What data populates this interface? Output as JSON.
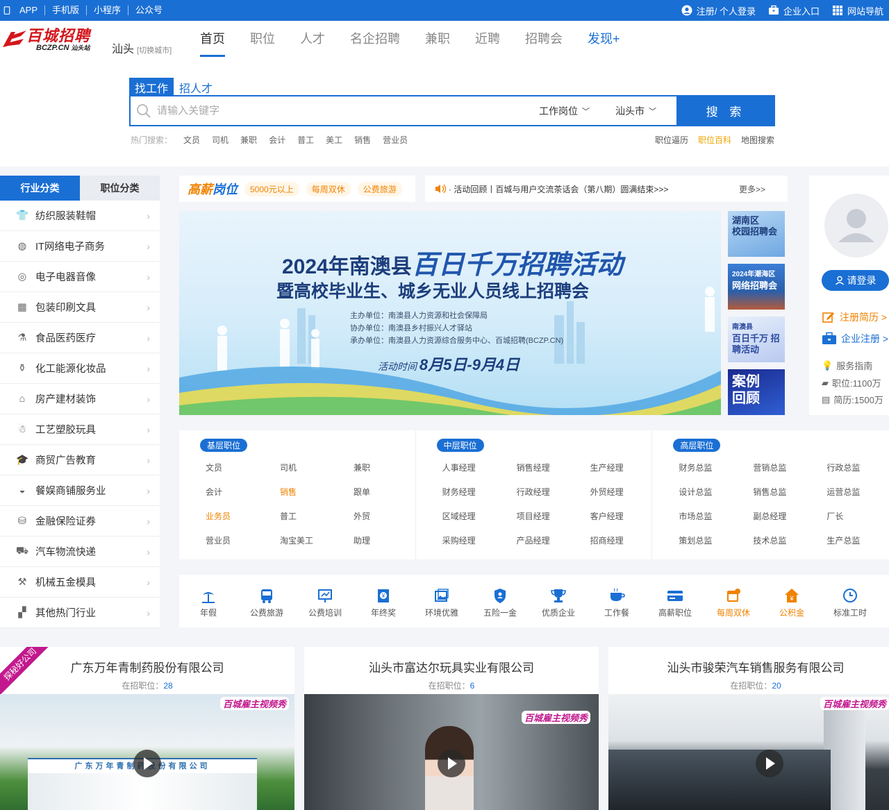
{
  "topbar": {
    "left": [
      "APP",
      "手机版",
      "小程序",
      "公众号"
    ],
    "register_login": "注册/ 个人登录",
    "enterprise": "企业入口",
    "sitenav": "网站导航"
  },
  "header": {
    "logo_cn": "百城招聘",
    "logo_en": "BCZP.CN",
    "logo_sub": "汕头站",
    "city": "汕头",
    "switch_city": "[切换城市]",
    "nav": [
      "首页",
      "职位",
      "人才",
      "名企招聘",
      "兼职",
      "近聘",
      "招聘会",
      "发现+"
    ]
  },
  "search": {
    "tabs": [
      "找工作",
      "招人才"
    ],
    "placeholder": "请输入关键字",
    "type_select": "工作岗位",
    "city_select": "汕头市",
    "button": "搜 索",
    "hot_label": "热门搜索：",
    "hot_words": [
      "文员",
      "司机",
      "兼职",
      "会计",
      "普工",
      "美工",
      "销售",
      "营业员"
    ],
    "links": [
      "职位逼历",
      "职位百科",
      "地图搜索"
    ]
  },
  "category": {
    "tabs": [
      "行业分类",
      "职位分类"
    ],
    "items": [
      {
        "label": "纺织服装鞋帽",
        "icon": "shirt-icon"
      },
      {
        "label": "IT网络电子商务",
        "icon": "globe-icon"
      },
      {
        "label": "电子电器音像",
        "icon": "disc-icon"
      },
      {
        "label": "包装印刷文具",
        "icon": "package-icon"
      },
      {
        "label": "食品医药医疗",
        "icon": "pill-icon"
      },
      {
        "label": "化工能源化妆品",
        "icon": "flask-icon"
      },
      {
        "label": "房产建材装饰",
        "icon": "house-icon"
      },
      {
        "label": "工艺塑胶玩具",
        "icon": "toy-icon"
      },
      {
        "label": "商贸广告教育",
        "icon": "graduation-icon"
      },
      {
        "label": "餐娱商铺服务业",
        "icon": "dish-icon"
      },
      {
        "label": "金融保险证券",
        "icon": "coins-icon"
      },
      {
        "label": "汽车物流快递",
        "icon": "truck-icon"
      },
      {
        "label": "机械五金模具",
        "icon": "wrench-icon"
      },
      {
        "label": "其他热门行业",
        "icon": "blocks-icon"
      }
    ]
  },
  "highpay": {
    "logo_a": "高薪",
    "logo_b": "岗位",
    "chips": [
      "5000元以上",
      "每周双休",
      "公费旅游"
    ]
  },
  "notice": {
    "text": "· 活动回顾丨百城与用户交流茶话会（第八期）圆满结束>>>",
    "more": "更多>>"
  },
  "banner": {
    "year": "2024年南澳县",
    "highlight": "百日千万招聘活动",
    "subtitle": "暨高校毕业生、城乡无业人员线上招聘会",
    "org_host": "主办单位：南澳县人力资源和社会保障局",
    "org_co": "协办单位：南澳县乡村振兴人才驿站",
    "org_exec": "承办单位：南澳县人力资源综合服务中心、百城招聘(BCZP.CN)",
    "date_label": "活动时间",
    "date_value": "8月5日-9月4日"
  },
  "thumbs": [
    {
      "line1": "湖南区",
      "line2": "校园招聘会"
    },
    {
      "line1": "2024年潮海区",
      "line2": "网络招聘会"
    },
    {
      "line1": "南澳县",
      "line2": "百日千万 招聘活动"
    },
    {
      "line1": "案例",
      "line2": "回顾"
    }
  ],
  "user": {
    "login": "请登录",
    "register_resume": "注册简历 >",
    "register_company": "企业注册 >",
    "guide": "服务指南",
    "jobs": "职位:1100万",
    "resumes": "简历:1500万"
  },
  "positions": [
    {
      "tag": "基层职位",
      "items": [
        "文员",
        "司机",
        "兼职",
        "会计",
        "销售",
        "跟单",
        "业务员",
        "普工",
        "外贸",
        "营业员",
        "淘宝美工",
        "助理"
      ],
      "orange": [
        4,
        6
      ]
    },
    {
      "tag": "中层职位",
      "items": [
        "人事经理",
        "销售经理",
        "生产经理",
        "财务经理",
        "行政经理",
        "外贸经理",
        "区域经理",
        "项目经理",
        "客户经理",
        "采购经理",
        "产品经理",
        "招商经理"
      ],
      "orange": []
    },
    {
      "tag": "高层职位",
      "items": [
        "财务总监",
        "营销总监",
        "行政总监",
        "设计总监",
        "销售总监",
        "运营总监",
        "市场总监",
        "副总经理",
        "厂长",
        "策划总监",
        "技术总监",
        "生产总监"
      ],
      "orange": []
    }
  ],
  "welfare": [
    {
      "label": "年假",
      "icon": "beach-icon",
      "orange": false
    },
    {
      "label": "公费旅游",
      "icon": "bus-icon",
      "orange": false
    },
    {
      "label": "公费培训",
      "icon": "board-icon",
      "orange": false
    },
    {
      "label": "年终奖",
      "icon": "money-icon",
      "orange": false
    },
    {
      "label": "环境优雅",
      "icon": "picture-icon",
      "orange": false
    },
    {
      "label": "五险一金",
      "icon": "shield-icon",
      "orange": false
    },
    {
      "label": "优质企业",
      "icon": "trophy-icon",
      "orange": false
    },
    {
      "label": "工作餐",
      "icon": "cup-icon",
      "orange": false
    },
    {
      "label": "高薪职位",
      "icon": "card-icon",
      "orange": false
    },
    {
      "label": "每周双休",
      "icon": "calendar-icon",
      "orange": true
    },
    {
      "label": "公积金",
      "icon": "house-money-icon",
      "orange": true
    },
    {
      "label": "标准工时",
      "icon": "clock-icon",
      "orange": false
    }
  ],
  "companies": [
    {
      "name": "广东万年青制药股份有限公司",
      "jobs_label": "在招职位：",
      "jobs": "28",
      "sign": "广东万年青制药股份有限公司"
    },
    {
      "name": "汕头市富达尔玩具实业有限公司",
      "jobs_label": "在招职位：",
      "jobs": "6",
      "sign": ""
    },
    {
      "name": "汕头市骏荣汽车销售服务有限公司",
      "jobs_label": "在招职位：",
      "jobs": "20",
      "sign": ""
    }
  ],
  "ribbon": "探秘好公司",
  "video_badge": "百城雇主视频秀",
  "colors": {
    "primary": "#1a6fd4",
    "accent": "#f08300",
    "magenta": "#c2188d"
  }
}
